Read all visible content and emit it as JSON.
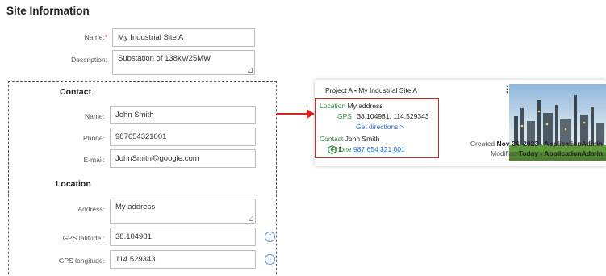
{
  "page": {
    "title": "Site Information"
  },
  "form": {
    "name_label": "Name:",
    "required_mark": "*",
    "name_value": "My Industrial Site A",
    "description_label": "Description:",
    "description_value": "Substation of 138kV/25MW"
  },
  "contact": {
    "heading": "Contact",
    "name_label": "Name:",
    "name_value": "John Smith",
    "phone_label": "Phone:",
    "phone_value": "987654321001",
    "email_label": "E-mail:",
    "email_value": "JohnSmith@google.com"
  },
  "location": {
    "heading": "Location",
    "address_label": "Address:",
    "address_value": "My address",
    "lat_label": "GPS latitude :",
    "lat_value": "38.104981",
    "lon_label": "GPS longitude:",
    "lon_value": "114.529343",
    "info_icon": "i"
  },
  "card": {
    "breadcrumb": "Project A • My Industrial Site A",
    "menu_icon": "⋮",
    "location_key": "Location",
    "location_value": "My address",
    "gps_key": "GPS",
    "gps_value": "38.104981, 114.529343",
    "directions_link": "Get directions >",
    "contact_key": "Contact",
    "contact_value": "John Smith",
    "phone_key": "Phone",
    "phone_value": " 987 654 321 001 ",
    "module_count": "1",
    "created_label": "Created",
    "created_value": "Nov 24, 2023 - ApplicationAdmin",
    "modified_label": "Modified",
    "modified_value": "Today - ApplicationAdmin"
  },
  "icons": {
    "info": "info-icon",
    "menu": "kebab-menu-icon",
    "module": "module-icon",
    "arrow": "arrow-right-icon"
  },
  "colors": {
    "highlight_red": "#d9241c",
    "key_green": "#2f8a3f",
    "link_blue": "#2f6fd1",
    "info_blue": "#5a8fd6"
  }
}
